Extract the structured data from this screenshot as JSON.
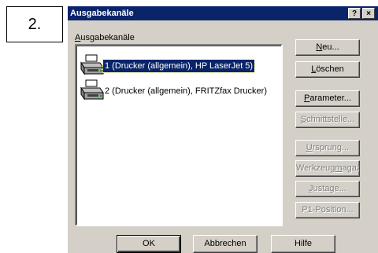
{
  "step": {
    "label": "2."
  },
  "window": {
    "title": "Ausgabekanäle",
    "help_label": "?",
    "close_label": "×"
  },
  "group": {
    "label_accel": "A",
    "label_rest": "usgabekanäle"
  },
  "list": {
    "items": [
      {
        "text": "1  (Drucker (allgemein), HP LaserJet 5)",
        "selected": true
      },
      {
        "text": "2  (Drucker (allgemein), FRITZfax Drucker)",
        "selected": false
      }
    ]
  },
  "buttons": {
    "new": {
      "accel": "N",
      "rest": "eu..."
    },
    "delete": {
      "accel": "L",
      "rest": "öschen"
    },
    "params": {
      "accel": "P",
      "rest": "arameter..."
    },
    "interface": {
      "accel": "S",
      "rest": "chnittstelle..."
    },
    "origin": {
      "accel": "U",
      "rest": "rsprung..."
    },
    "toolmag": {
      "pre": "Werkzeug",
      "accel": "m",
      "rest": "agazin..."
    },
    "adjust": {
      "accel": "J",
      "rest": "ustage..."
    },
    "p1": {
      "label": "P1-Position..."
    }
  },
  "footer": {
    "ok": "OK",
    "cancel": "Abbrechen",
    "help": "Hilfe"
  }
}
